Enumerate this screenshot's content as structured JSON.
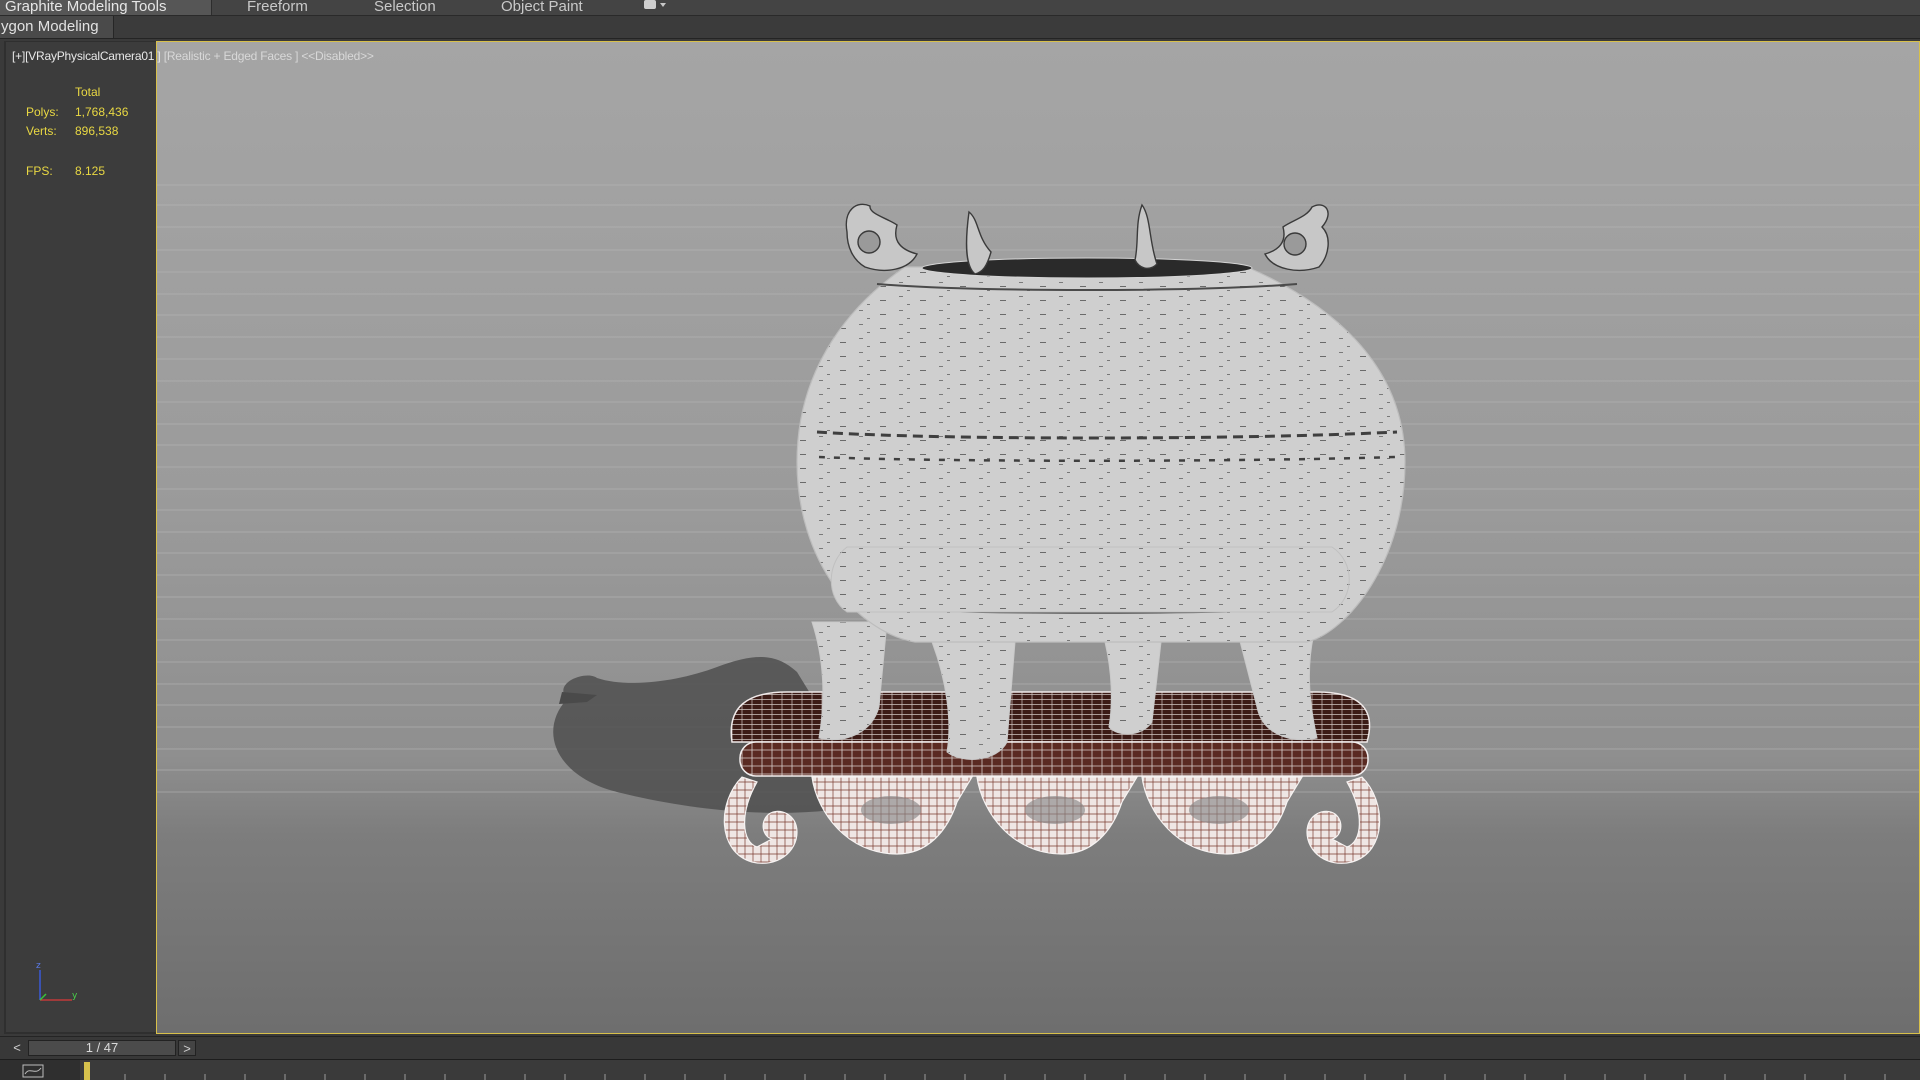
{
  "ribbon": {
    "tabs": [
      {
        "label": "Graphite Modeling Tools",
        "active": true
      },
      {
        "label": "Freeform"
      },
      {
        "label": "Selection"
      },
      {
        "label": "Object Paint"
      }
    ],
    "extra_icon": "dropdown-toggle-icon"
  },
  "panel": {
    "title": "ygon Modeling"
  },
  "viewport": {
    "label_prefix": "[+]",
    "camera": "[VRayPhysicalCamera01 ]",
    "shading": "[Realistic + Edged Faces ]",
    "state": "<<Disabled>>",
    "border_color": "#d8c04a"
  },
  "stats": {
    "total_label": "Total",
    "polys_label": "Polys:",
    "polys_value": "1,768,436",
    "verts_label": "Verts:",
    "verts_value": "896,538",
    "fps_label": "FPS:",
    "fps_value": "8.125",
    "color": "#e9d843"
  },
  "axis": {
    "z_label": "z",
    "y_label": "y"
  },
  "timeslider": {
    "prev_label": "<",
    "frame_text": "1 / 47",
    "next_label": ">"
  },
  "trackbar": {
    "icon": "curve-editor-icon"
  }
}
